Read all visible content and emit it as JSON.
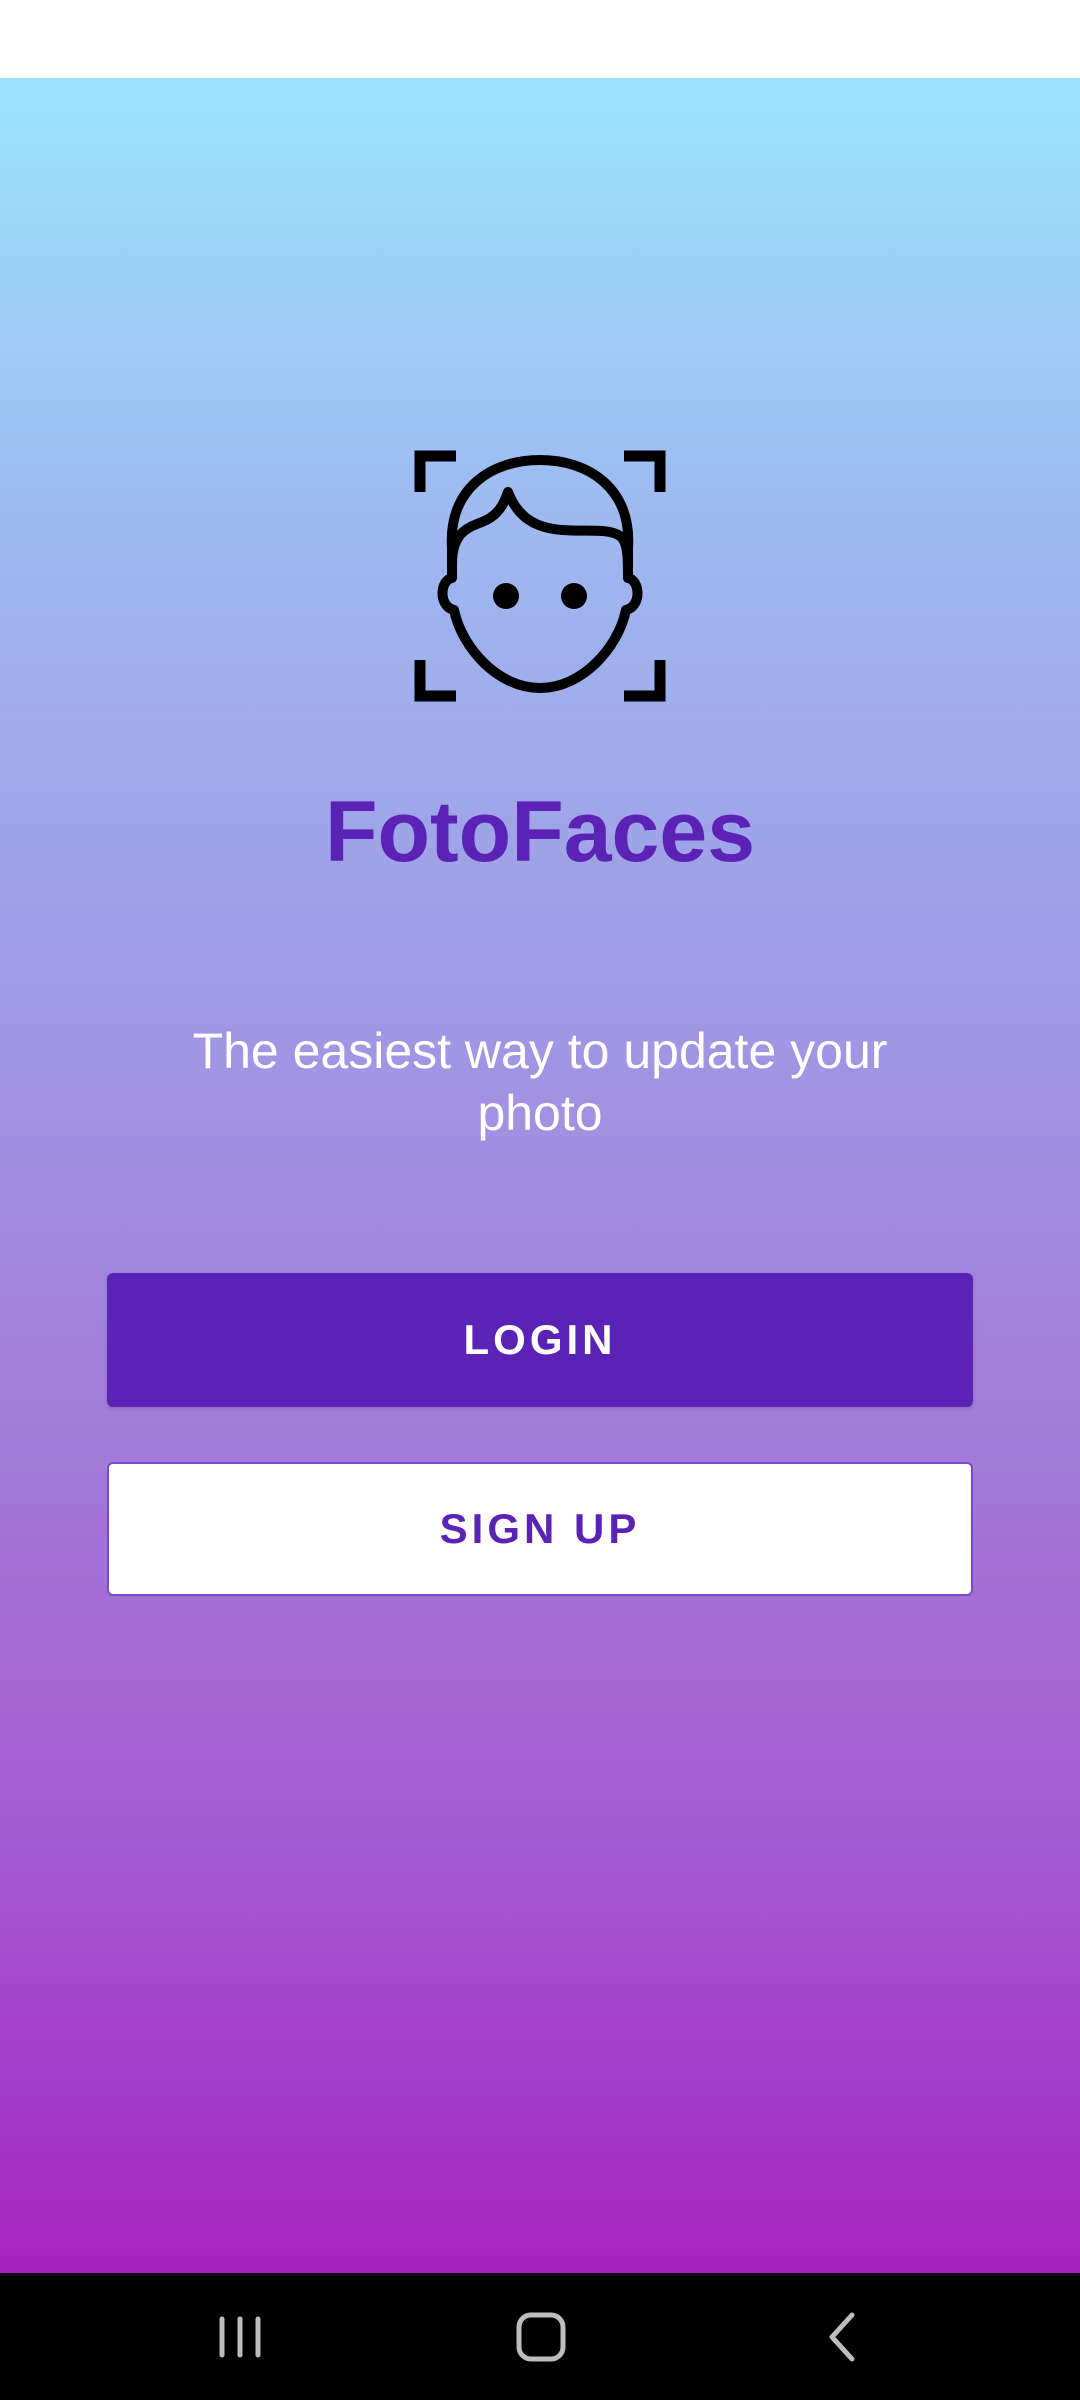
{
  "app": {
    "title": "FotoFaces",
    "tagline": "The easiest way to update your photo",
    "logo_icon": "face-scan-icon"
  },
  "actions": {
    "login_label": "LOGIN",
    "signup_label": "SIGN UP"
  },
  "colors": {
    "brand_purple": "#5b23b5",
    "gradient_top": "#9ce3fd",
    "gradient_bottom": "#a424c0",
    "button_secondary_bg": "#ffffff"
  },
  "navigation": {
    "buttons": [
      "recent-apps-icon",
      "home-icon",
      "back-icon"
    ]
  }
}
